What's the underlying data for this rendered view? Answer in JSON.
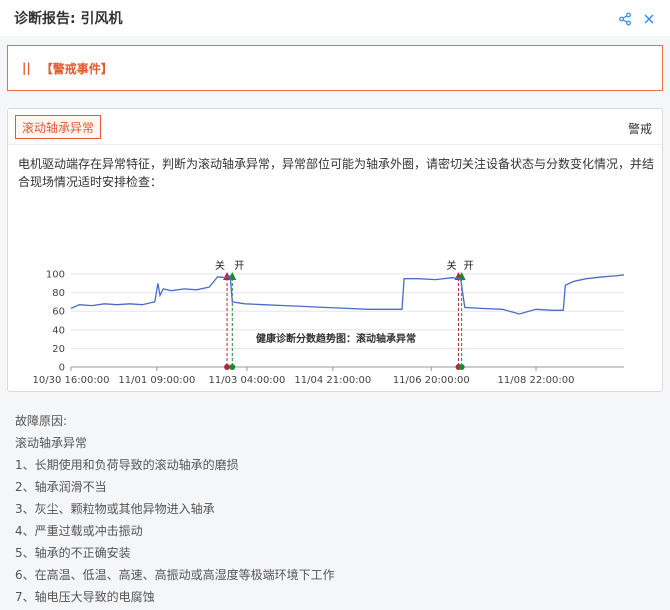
{
  "header": {
    "title": "诊断报告: 引风机",
    "share_icon": "share-icon",
    "close_icon": "close-icon"
  },
  "alert": {
    "bar_glyph": "||",
    "text": "【警戒事件】",
    "color": "#e05b2e"
  },
  "event": {
    "tag": "滚动轴承异常",
    "level": "警戒",
    "description": "电机驱动端存在异常特征，判断为滚动轴承异常，异常部位可能为轴承外圈，请密切关注设备状态与分数变化情况，并结合现场情况适时安排检查："
  },
  "chart_data": {
    "type": "line",
    "title": "健康诊断分数趋势图：滚动轴承异常",
    "xlabel": "",
    "ylabel": "",
    "ylim": [
      0,
      100
    ],
    "yticks": [
      0,
      20,
      40,
      60,
      80,
      100
    ],
    "xlim": [
      "10/30 16:00",
      "11/10 16:00"
    ],
    "xticks": [
      "10/30 16:00:00",
      "11/01 09:00:00",
      "11/03 04:00:00",
      "11/04 21:00:00",
      "11/06 20:00:00",
      "11/08 22:00:00"
    ],
    "xtick_positions": [
      "10/30 16:00",
      "11/01 09:00",
      "11/03 04:00",
      "11/04 21:00",
      "11/06 20:00",
      "11/08 22:00"
    ],
    "line_color": "#4a6cc8",
    "grid": true,
    "legend": "none",
    "series": [
      {
        "points": [
          [
            "10/30 16:00",
            63
          ],
          [
            "10/30 20:00",
            67
          ],
          [
            "10/31 02:00",
            66
          ],
          [
            "10/31 08:00",
            68
          ],
          [
            "10/31 14:00",
            67
          ],
          [
            "10/31 20:00",
            68
          ],
          [
            "11/01 02:00",
            67
          ],
          [
            "11/01 06:00",
            69
          ],
          [
            "11/01 08:00",
            70
          ],
          [
            "11/01 09:30",
            90
          ],
          [
            "11/01 10:30",
            77
          ],
          [
            "11/01 12:00",
            84
          ],
          [
            "11/01 16:00",
            82
          ],
          [
            "11/01 22:00",
            84
          ],
          [
            "11/02 04:00",
            83
          ],
          [
            "11/02 10:00",
            86
          ],
          [
            "11/02 14:00",
            97
          ],
          [
            "11/02 18:00",
            96
          ],
          [
            "11/02 20:00",
            98
          ],
          [
            "11/02 21:00",
            70
          ],
          [
            "11/03 03:00",
            68
          ],
          [
            "11/03 12:00",
            67
          ],
          [
            "11/03 22:00",
            66
          ],
          [
            "11/04 08:00",
            65
          ],
          [
            "11/04 18:00",
            64
          ],
          [
            "11/05 04:00",
            63
          ],
          [
            "11/05 14:00",
            62
          ],
          [
            "11/06 00:00",
            62
          ],
          [
            "11/06 06:00",
            62
          ],
          [
            "11/06 07:00",
            95
          ],
          [
            "11/06 14:00",
            95
          ],
          [
            "11/06 22:00",
            94
          ],
          [
            "11/07 06:00",
            96
          ],
          [
            "11/07 10:00",
            95
          ],
          [
            "11/07 12:00",
            64
          ],
          [
            "11/07 20:00",
            63
          ],
          [
            "11/08 06:00",
            62
          ],
          [
            "11/08 14:00",
            57
          ],
          [
            "11/08 22:00",
            62
          ],
          [
            "11/09 06:00",
            61
          ],
          [
            "11/09 11:00",
            61
          ],
          [
            "11/09 12:00",
            88
          ],
          [
            "11/09 16:00",
            92
          ],
          [
            "11/09 22:00",
            95
          ],
          [
            "11/10 06:00",
            97
          ],
          [
            "11/10 12:00",
            98
          ],
          [
            "11/10 16:00",
            99
          ]
        ]
      }
    ],
    "annotations": [
      {
        "time": "11/02 18:30",
        "label": "关",
        "color": "#b02840",
        "style": "dashed"
      },
      {
        "time": "11/02 21:00",
        "label": "开",
        "color": "#1a8a2a",
        "style": "dashed"
      },
      {
        "time": "11/07 09:00",
        "label": "关",
        "color": "#b02840",
        "style": "dashed"
      },
      {
        "time": "11/07 10:30",
        "label": "开",
        "color": "#1a8a2a",
        "style": "dashed"
      }
    ]
  },
  "reasons": {
    "heading": "故障原因:",
    "items": [
      "滚动轴承异常",
      "1、长期使用和负荷导致的滚动轴承的磨损",
      "2、轴承润滑不当",
      "3、灰尘、颗粒物或其他异物进入轴承",
      "4、严重过载或冲击振动",
      "5、轴承的不正确安装",
      "6、在高温、低温、高速、高振动或高湿度等极端环境下工作",
      "7、轴电压大导致的电腐蚀"
    ]
  }
}
